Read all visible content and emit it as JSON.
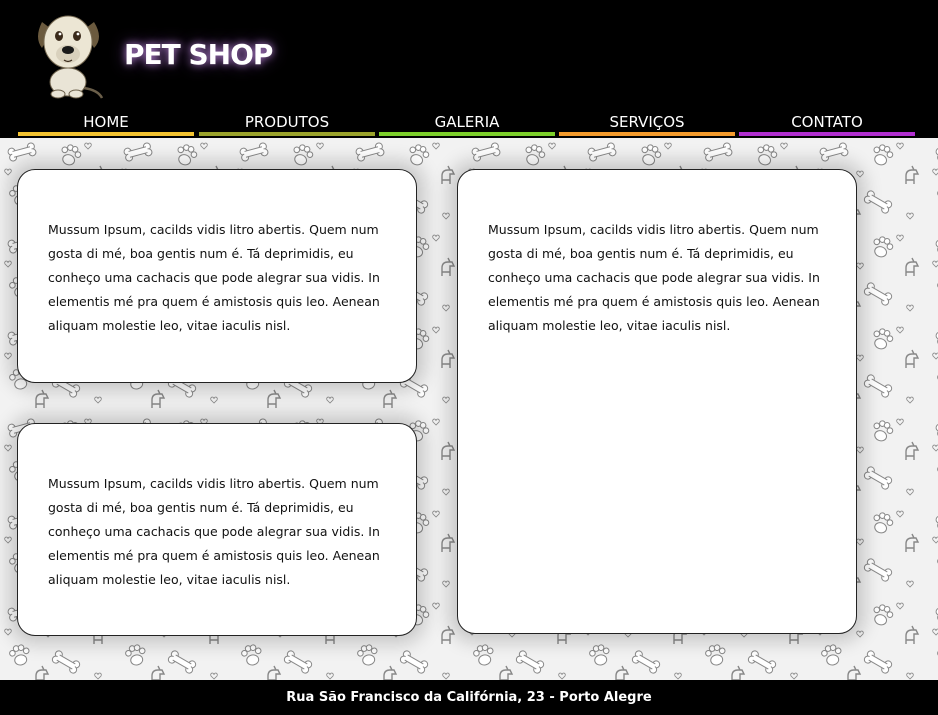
{
  "header": {
    "brand": "PET SHOP",
    "logo_icon": "dog-mascot-icon"
  },
  "nav": {
    "items": [
      {
        "label": "HOME",
        "color": "#f2c230"
      },
      {
        "label": "PRODUTOS",
        "color": "#9aa22b"
      },
      {
        "label": "GALERIA",
        "color": "#7ccf2a"
      },
      {
        "label": "SERVIÇOS",
        "color": "#f39a2c"
      },
      {
        "label": "CONTATO",
        "color": "#b12fd0"
      }
    ]
  },
  "main": {
    "cards": [
      {
        "text": "Mussum Ipsum, cacilds vidis litro abertis. Quem num gosta di mé, boa gentis num é. Tá deprimidis, eu conheço uma cachacis que pode alegrar sua vidis. In elementis mé pra quem é amistosis quis leo. Aenean aliquam molestie leo, vitae iaculis nisl."
      },
      {
        "text": "Mussum Ipsum, cacilds vidis litro abertis. Quem num gosta di mé, boa gentis num é. Tá deprimidis, eu conheço uma cachacis que pode alegrar sua vidis. In elementis mé pra quem é amistosis quis leo. Aenean aliquam molestie leo, vitae iaculis nisl."
      },
      {
        "text": "Mussum Ipsum, cacilds vidis litro abertis. Quem num gosta di mé, boa gentis num é. Tá deprimidis, eu conheço uma cachacis que pode alegrar sua vidis. In elementis mé pra quem é amistosis quis leo. Aenean aliquam molestie leo, vitae iaculis nisl."
      }
    ],
    "background_pattern": [
      "bone-icon",
      "paw-icon",
      "dog-icon",
      "heart-icon"
    ]
  },
  "footer": {
    "address": "Rua São Francisco da Califórnia, 23 - Porto Alegre"
  }
}
